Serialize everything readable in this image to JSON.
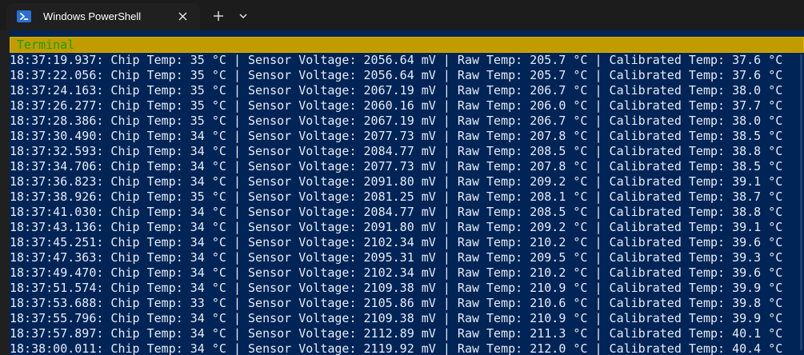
{
  "tab": {
    "title": "Windows PowerShell",
    "icon": "powershell-icon"
  },
  "toolbar": {
    "close_icon": "close-icon",
    "new_tab_icon": "plus-icon",
    "dropdown_icon": "chevron-down-icon"
  },
  "terminal": {
    "header": "Terminal",
    "lines": [
      "18:37:19.937: Chip Temp: 35 °C | Sensor Voltage: 2056.64 mV | Raw Temp: 205.7 °C | Calibrated Temp: 37.6 °C",
      "18:37:22.056: Chip Temp: 35 °C | Sensor Voltage: 2056.64 mV | Raw Temp: 205.7 °C | Calibrated Temp: 37.6 °C",
      "18:37:24.163: Chip Temp: 35 °C | Sensor Voltage: 2067.19 mV | Raw Temp: 206.7 °C | Calibrated Temp: 38.0 °C",
      "18:37:26.277: Chip Temp: 35 °C | Sensor Voltage: 2060.16 mV | Raw Temp: 206.0 °C | Calibrated Temp: 37.7 °C",
      "18:37:28.386: Chip Temp: 35 °C | Sensor Voltage: 2067.19 mV | Raw Temp: 206.7 °C | Calibrated Temp: 38.0 °C",
      "18:37:30.490: Chip Temp: 34 °C | Sensor Voltage: 2077.73 mV | Raw Temp: 207.8 °C | Calibrated Temp: 38.5 °C",
      "18:37:32.593: Chip Temp: 34 °C | Sensor Voltage: 2084.77 mV | Raw Temp: 208.5 °C | Calibrated Temp: 38.8 °C",
      "18:37:34.706: Chip Temp: 34 °C | Sensor Voltage: 2077.73 mV | Raw Temp: 207.8 °C | Calibrated Temp: 38.5 °C",
      "18:37:36.823: Chip Temp: 34 °C | Sensor Voltage: 2091.80 mV | Raw Temp: 209.2 °C | Calibrated Temp: 39.1 °C",
      "18:37:38.926: Chip Temp: 35 °C | Sensor Voltage: 2081.25 mV | Raw Temp: 208.1 °C | Calibrated Temp: 38.7 °C",
      "18:37:41.030: Chip Temp: 34 °C | Sensor Voltage: 2084.77 mV | Raw Temp: 208.5 °C | Calibrated Temp: 38.8 °C",
      "18:37:43.136: Chip Temp: 34 °C | Sensor Voltage: 2091.80 mV | Raw Temp: 209.2 °C | Calibrated Temp: 39.1 °C",
      "18:37:45.251: Chip Temp: 34 °C | Sensor Voltage: 2102.34 mV | Raw Temp: 210.2 °C | Calibrated Temp: 39.6 °C",
      "18:37:47.363: Chip Temp: 34 °C | Sensor Voltage: 2095.31 mV | Raw Temp: 209.5 °C | Calibrated Temp: 39.3 °C",
      "18:37:49.470: Chip Temp: 34 °C | Sensor Voltage: 2102.34 mV | Raw Temp: 210.2 °C | Calibrated Temp: 39.6 °C",
      "18:37:51.574: Chip Temp: 34 °C | Sensor Voltage: 2109.38 mV | Raw Temp: 210.9 °C | Calibrated Temp: 39.9 °C",
      "18:37:53.688: Chip Temp: 33 °C | Sensor Voltage: 2105.86 mV | Raw Temp: 210.6 °C | Calibrated Temp: 39.8 °C",
      "18:37:55.796: Chip Temp: 34 °C | Sensor Voltage: 2109.38 mV | Raw Temp: 210.9 °C | Calibrated Temp: 39.9 °C",
      "18:37:57.897: Chip Temp: 34 °C | Sensor Voltage: 2112.89 mV | Raw Temp: 211.3 °C | Calibrated Temp: 40.1 °C",
      "18:38:00.011: Chip Temp: 34 °C | Sensor Voltage: 2119.92 mV | Raw Temp: 212.0 °C | Calibrated Temp: 40.4 °C"
    ]
  },
  "colors": {
    "terminal_background": "#012456",
    "header_bar": "#c19c00",
    "header_text": "#13a10e",
    "text": "#e6ecf5",
    "tab_bar": "#1c1c1c",
    "tab_active": "#202020"
  }
}
